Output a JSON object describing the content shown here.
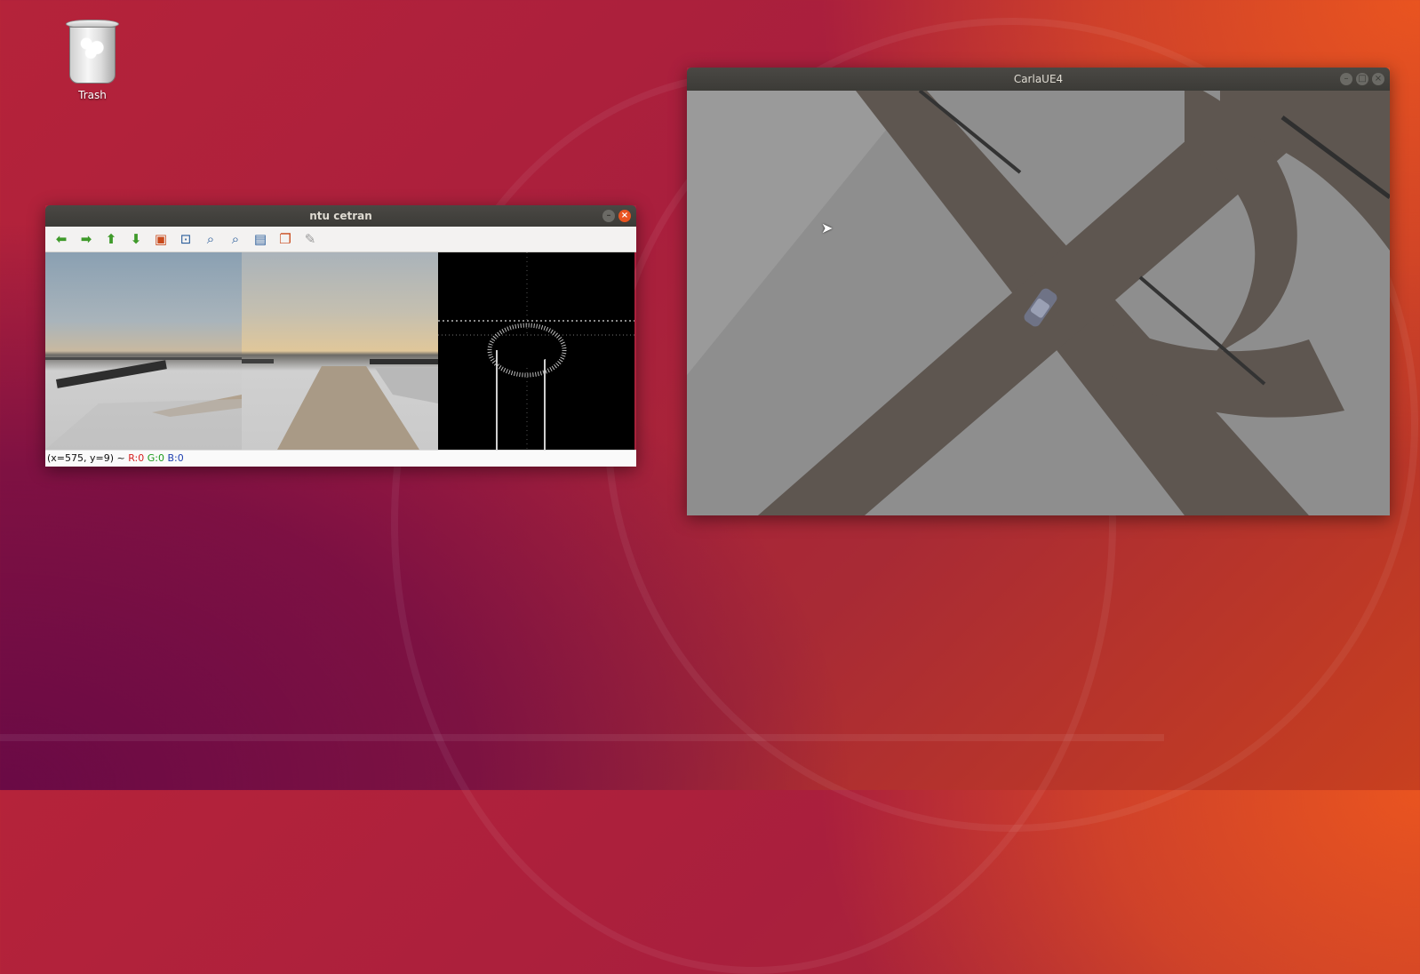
{
  "desktop": {
    "trash_label": "Trash"
  },
  "ntu_window": {
    "title": "ntu cetran",
    "toolbar": [
      {
        "name": "arrow-left-icon",
        "glyph": "⬅",
        "tone": "green"
      },
      {
        "name": "arrow-right-icon",
        "glyph": "➡",
        "tone": "green"
      },
      {
        "name": "arrow-up-icon",
        "glyph": "⬆",
        "tone": "green"
      },
      {
        "name": "arrow-down-icon",
        "glyph": "⬇",
        "tone": "green"
      },
      {
        "name": "fit-image-icon",
        "glyph": "▣",
        "tone": "box"
      },
      {
        "name": "zoom-region-icon",
        "glyph": "⊡",
        "tone": "blue"
      },
      {
        "name": "zoom-in-icon",
        "glyph": "⌕",
        "tone": "blue"
      },
      {
        "name": "zoom-out-icon",
        "glyph": "⌕",
        "tone": "blue"
      },
      {
        "name": "save-icon",
        "glyph": "▤",
        "tone": "blue"
      },
      {
        "name": "copy-icon",
        "glyph": "❐",
        "tone": "box"
      },
      {
        "name": "brush-icon",
        "glyph": "✎",
        "tone": "gray"
      }
    ],
    "status": {
      "coords": "(x=575, y=9) ~ ",
      "r": "R:0",
      "g": "G:0",
      "b": "B:0"
    }
  },
  "carla_window": {
    "title": "CarlaUE4"
  },
  "colors": {
    "ubuntu_orange": "#e95420",
    "titlebar": "#3c3b37",
    "road": "#5e5650",
    "ground": "#8b8b8b"
  }
}
